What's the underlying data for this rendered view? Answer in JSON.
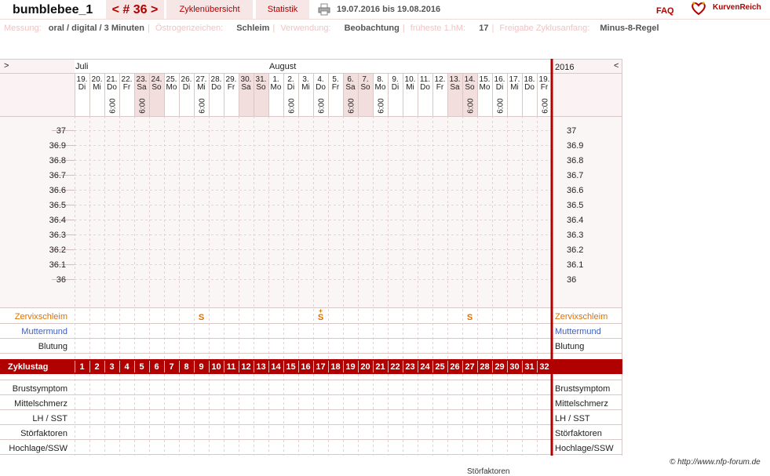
{
  "header": {
    "username": "bumblebee_1",
    "cycle_nav": "< # 36 >",
    "cycles_overview": "Zyklenübersicht",
    "statistics": "Statistik",
    "date_range": "19.07.2016 bis 19.08.2016",
    "faq": "FAQ",
    "brand": "KurvenReich",
    "printer_icon": "printer-icon",
    "logo_icon": "heart-logo-icon"
  },
  "info": {
    "measure_label": "Messung:",
    "measure_value": "oral / digital / 3 Minuten",
    "estrogen_label": "Östrogenzeichen:",
    "estrogen_value": "Schleim",
    "usage_label": "Verwendung:",
    "usage_value": "Beobachtung",
    "earliest_label": "früheste 1.hM:",
    "earliest_value": "17",
    "release_label": "Freigabe Zyklusanfang:",
    "release_value": "Minus-8-Regel"
  },
  "chart_data": {
    "type": "table",
    "nav_prev": ">",
    "nav_next": "<",
    "year": "2016",
    "months": [
      {
        "label": "Juli",
        "start_index": 0
      },
      {
        "label": "August",
        "start_index": 13
      }
    ],
    "days": [
      {
        "d": "19.",
        "w": "Di"
      },
      {
        "d": "20.",
        "w": "Mi"
      },
      {
        "d": "21.",
        "w": "Do"
      },
      {
        "d": "22.",
        "w": "Fr"
      },
      {
        "d": "23.",
        "w": "Sa"
      },
      {
        "d": "24.",
        "w": "So"
      },
      {
        "d": "25.",
        "w": "Mo"
      },
      {
        "d": "26.",
        "w": "Di"
      },
      {
        "d": "27.",
        "w": "Mi"
      },
      {
        "d": "28.",
        "w": "Do"
      },
      {
        "d": "29.",
        "w": "Fr"
      },
      {
        "d": "30.",
        "w": "Sa"
      },
      {
        "d": "31.",
        "w": "So"
      },
      {
        "d": "1.",
        "w": "Mo"
      },
      {
        "d": "2.",
        "w": "Di"
      },
      {
        "d": "3.",
        "w": "Mi"
      },
      {
        "d": "4.",
        "w": "Do"
      },
      {
        "d": "5.",
        "w": "Fr"
      },
      {
        "d": "6.",
        "w": "Sa"
      },
      {
        "d": "7.",
        "w": "So"
      },
      {
        "d": "8.",
        "w": "Mo"
      },
      {
        "d": "9.",
        "w": "Di"
      },
      {
        "d": "10.",
        "w": "Mi"
      },
      {
        "d": "11.",
        "w": "Do"
      },
      {
        "d": "12.",
        "w": "Fr"
      },
      {
        "d": "13.",
        "w": "Sa"
      },
      {
        "d": "14.",
        "w": "So"
      },
      {
        "d": "15.",
        "w": "Mo"
      },
      {
        "d": "16.",
        "w": "Di"
      },
      {
        "d": "17.",
        "w": "Mi"
      },
      {
        "d": "18.",
        "w": "Do"
      },
      {
        "d": "19.",
        "w": "Fr"
      }
    ],
    "weekend_indices": [
      4,
      5,
      11,
      12,
      18,
      19,
      25,
      26
    ],
    "time_label": "6:00",
    "time_indices": [
      2,
      4,
      8,
      14,
      16,
      18,
      20,
      26,
      28,
      31
    ],
    "temperature_ticks": [
      "37",
      "36.9",
      "36.8",
      "36.7",
      "36.6",
      "36.5",
      "36.4",
      "36.3",
      "36.2",
      "36.1",
      "36"
    ],
    "temperatures": [],
    "rows_top": [
      {
        "label": "Zervixschleim",
        "color": "#e07000"
      },
      {
        "label": "Muttermund",
        "color": "#4060c0"
      },
      {
        "label": "Blutung",
        "color": "#222222"
      }
    ],
    "mucus_marks": [
      {
        "index": 8,
        "symbol": "S",
        "accent": ""
      },
      {
        "index": 16,
        "symbol": "S",
        "accent": "+"
      },
      {
        "index": 26,
        "symbol": "S",
        "accent": ""
      }
    ],
    "cycle_day_label": "Zyklustag",
    "cycle_days": [
      "1",
      "2",
      "3",
      "4",
      "5",
      "6",
      "7",
      "8",
      "9",
      "10",
      "11",
      "12",
      "13",
      "14",
      "15",
      "16",
      "17",
      "18",
      "19",
      "20",
      "21",
      "22",
      "23",
      "24",
      "25",
      "26",
      "27",
      "28",
      "29",
      "30",
      "31",
      "32"
    ],
    "rows_bottom": [
      "Brustsymptom",
      "Mittelschmerz",
      "LH / SST",
      "Störfaktoren",
      "Hochlage/SSW"
    ],
    "colors": {
      "accent": "#b00000",
      "grid": "#d8c8c8",
      "weekend": "#f3dede",
      "panel": "#fbf3f3"
    }
  },
  "footer": {
    "copyright": "© http://www.nfp-forum.de",
    "partial_label": "Störfaktoren"
  }
}
